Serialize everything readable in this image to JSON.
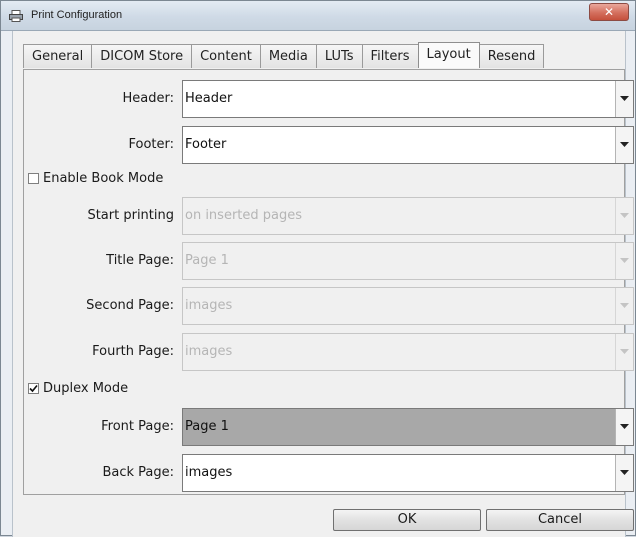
{
  "window": {
    "title": "Print Configuration",
    "close_label": "✕"
  },
  "tabs": [
    {
      "label": "General"
    },
    {
      "label": "DICOM Store"
    },
    {
      "label": "Content"
    },
    {
      "label": "Media"
    },
    {
      "label": "LUTs"
    },
    {
      "label": "Filters"
    },
    {
      "label": "Layout",
      "active": true
    },
    {
      "label": "Resend"
    }
  ],
  "layout": {
    "header": {
      "label": "Header:",
      "value": "Header"
    },
    "footer": {
      "label": "Footer:",
      "value": "Footer"
    },
    "book_mode": {
      "label": "Enable Book Mode",
      "checked": false
    },
    "start_printing": {
      "label": "Start printing",
      "value": "on inserted pages"
    },
    "title_page": {
      "label": "Title Page:",
      "value": "Page 1"
    },
    "second_page": {
      "label": "Second Page:",
      "value": "images"
    },
    "fourth_page": {
      "label": "Fourth Page:",
      "value": "images"
    },
    "duplex_mode": {
      "label": "Duplex Mode",
      "checked": true
    },
    "front_page": {
      "label": "Front Page:",
      "value": "Page 1"
    },
    "back_page": {
      "label": "Back Page:",
      "value": "images"
    }
  },
  "buttons": {
    "ok": "OK",
    "cancel": "Cancel"
  },
  "icons": {
    "window_icon": "printer-icon",
    "dropdown": "chevron-down-icon",
    "check": "checkmark-icon"
  }
}
